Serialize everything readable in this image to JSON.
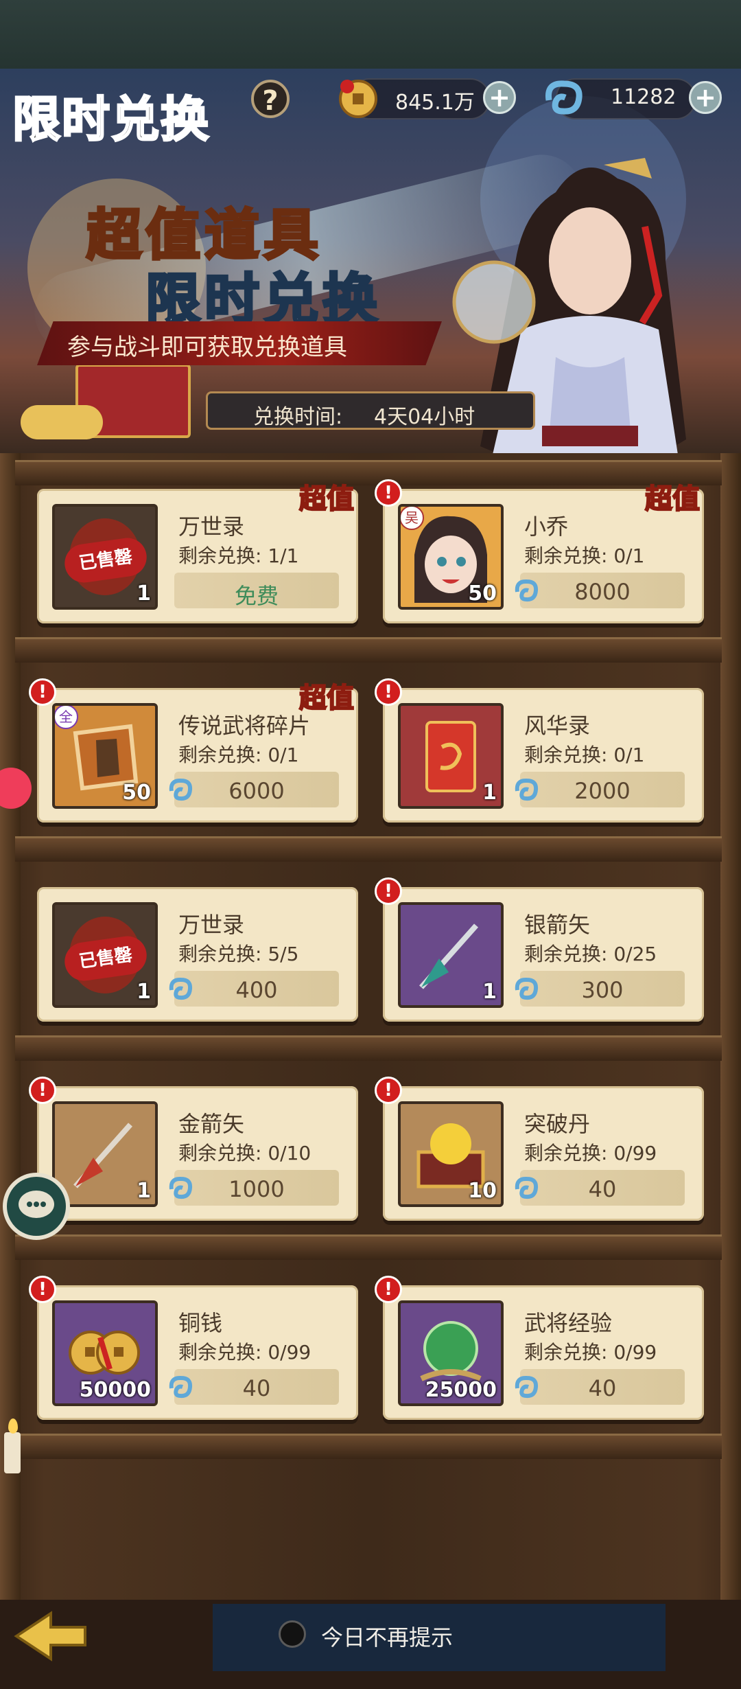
{
  "header": {
    "title": "限时兑换",
    "help_label": "?",
    "currencies": [
      {
        "icon": "coin-icon",
        "value": "845.1万"
      },
      {
        "icon": "jade-icon",
        "value": "11282"
      }
    ],
    "plus_label": "+"
  },
  "banner": {
    "headline_1": "超值道具",
    "headline_2": "限时兑换",
    "subtitle": "参与战斗即可获取兑换道具",
    "time_label": "兑换时间:",
    "time_value": "4天04小时"
  },
  "deal_tag": "超值",
  "sold_out_label": "已售罄",
  "faction_wu": "吴",
  "faction_all": "全",
  "items": [
    {
      "name": "万世录",
      "remain": "剩余兑换: 1/1",
      "price": "免费",
      "qty": "1"
    },
    {
      "name": "小乔",
      "remain": "剩余兑换: 0/1",
      "price": "8000",
      "qty": "50"
    },
    {
      "name": "传说武将碎片",
      "remain": "剩余兑换: 0/1",
      "price": "6000",
      "qty": "50"
    },
    {
      "name": "风华录",
      "remain": "剩余兑换: 0/1",
      "price": "2000",
      "qty": "1"
    },
    {
      "name": "万世录",
      "remain": "剩余兑换: 5/5",
      "price": "400",
      "qty": "1"
    },
    {
      "name": "银箭矢",
      "remain": "剩余兑换: 0/25",
      "price": "300",
      "qty": "1"
    },
    {
      "name": "金箭矢",
      "remain": "剩余兑换: 0/10",
      "price": "1000",
      "qty": "1"
    },
    {
      "name": "突破丹",
      "remain": "剩余兑换: 0/99",
      "price": "40",
      "qty": "10"
    },
    {
      "name": "铜钱",
      "remain": "剩余兑换: 0/99",
      "price": "40",
      "qty": "50000"
    },
    {
      "name": "武将经验",
      "remain": "剩余兑换: 0/99",
      "price": "40",
      "qty": "25000"
    }
  ],
  "alert_label": "!",
  "footer": {
    "dont_show_today": "今日不再提示"
  },
  "colors": {
    "card_bg": "#f3e6c6",
    "alert_red": "#d21e1e",
    "free_green": "#3e8c5a"
  }
}
